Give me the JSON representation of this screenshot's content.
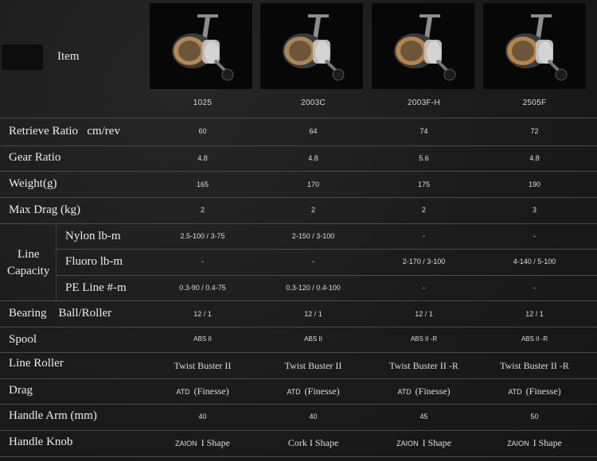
{
  "header": {
    "item_label": "Item",
    "models": [
      "1025",
      "2003C",
      "2003F-H",
      "2505F"
    ]
  },
  "rows": [
    {
      "label": "Retrieve Ratio",
      "unit": "cm/rev",
      "values": [
        "60",
        "64",
        "74",
        "72"
      ]
    },
    {
      "label": "Gear Ratio",
      "values": [
        "4.8",
        "4.8",
        "5.6",
        "4.8"
      ]
    },
    {
      "label": "Weight(g)",
      "values": [
        "165",
        "170",
        "175",
        "190"
      ]
    },
    {
      "label": "Max Drag (kg)",
      "values": [
        "2",
        "2",
        "2",
        "3"
      ]
    }
  ],
  "line_capacity": {
    "label_line1": "Line",
    "label_line2": "Capacity",
    "subrows": [
      {
        "label": "Nylon lb-m",
        "values": [
          "2.5-100 / 3-75",
          "2-150 / 3-100",
          "-",
          "-"
        ]
      },
      {
        "label": "Fluoro lb-m",
        "values": [
          "-",
          "-",
          "2-170 / 3-100",
          "4-140 / 5-100"
        ]
      },
      {
        "label": "PE Line #-m",
        "values": [
          "0.3-90 / 0.4-75",
          "0.3-120 / 0.4-100",
          "-",
          "-"
        ]
      }
    ]
  },
  "bearing": {
    "label": "Bearing",
    "sub": "Ball/Roller",
    "values": [
      "12 / 1",
      "12 / 1",
      "12 / 1",
      "12 / 1"
    ]
  },
  "spool": {
    "label": "Spool",
    "values": [
      "ABS II",
      "ABS II",
      "ABS II -R",
      "ABS II -R"
    ]
  },
  "line_roller": {
    "label": "Line Roller",
    "values": [
      "Twist Buster II",
      "Twist Buster II",
      "Twist Buster II -R",
      "Twist Buster II -R"
    ]
  },
  "drag": {
    "label": "Drag",
    "atd": [
      "ATD",
      "ATD",
      "ATD",
      "ATD"
    ],
    "mode": [
      "(Finesse)",
      "(Finesse)",
      "(Finesse)",
      "(Finesse)"
    ]
  },
  "handle_arm": {
    "label": "Handle Arm (mm)",
    "values": [
      "40",
      "40",
      "45",
      "50"
    ]
  },
  "handle_knob": {
    "label": "Handle Knob",
    "prefix": [
      "ZAION",
      "",
      "ZAION",
      "ZAION"
    ],
    "shape": [
      "I Shape",
      "Cork I Shape",
      "I Shape",
      "I Shape"
    ]
  },
  "colors": {
    "background": "#1b1b1b",
    "line": "#4a4a4a",
    "text": "#e8e8e8",
    "reel_gold": "#b08a57"
  },
  "icons": [
    "reel-photo"
  ]
}
